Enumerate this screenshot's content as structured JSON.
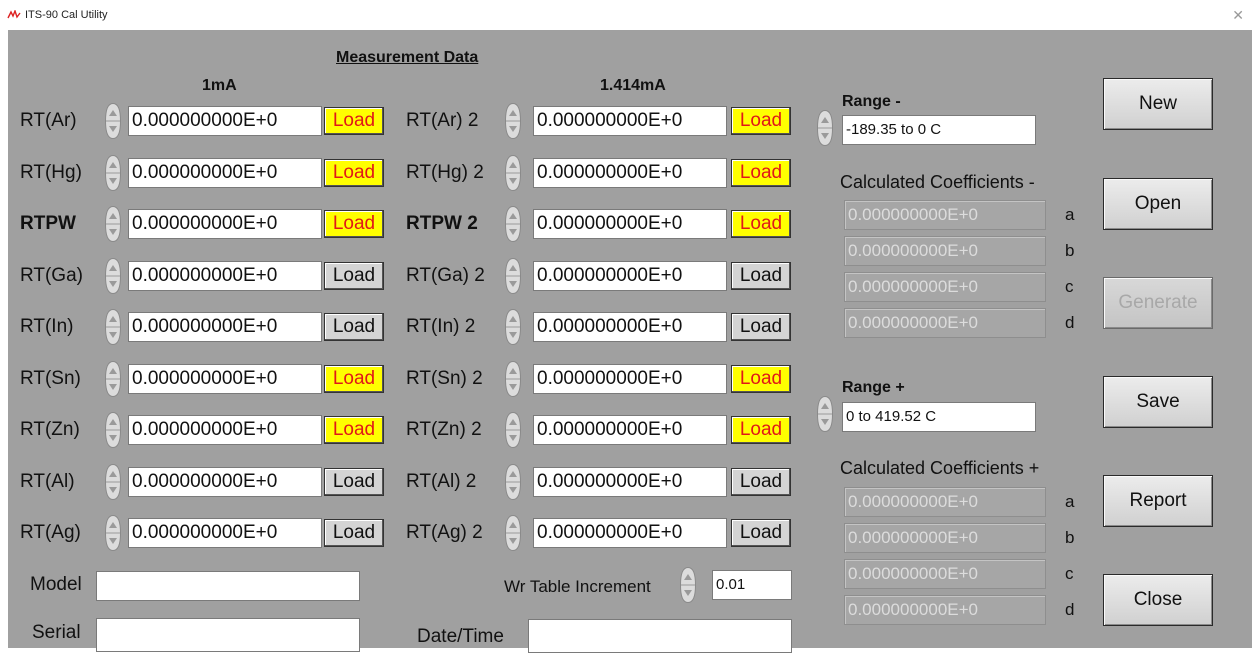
{
  "window": {
    "title": "ITS-90 Cal Utility",
    "close_glyph": "✕"
  },
  "measurement": {
    "title": "Measurement Data",
    "col1_header": "1mA",
    "col2_header": "1.414mA",
    "load_label": "Load",
    "rows": [
      {
        "label1": "RT(Ar)",
        "value1": "0.000000000E+0",
        "hl1": true,
        "label2": "RT(Ar) 2",
        "value2": "0.000000000E+0",
        "hl2": true
      },
      {
        "label1": "RT(Hg)",
        "value1": "0.000000000E+0",
        "hl1": true,
        "label2": "RT(Hg) 2",
        "value2": "0.000000000E+0",
        "hl2": true
      },
      {
        "label1": "RTPW",
        "value1": "0.000000000E+0",
        "hl1": true,
        "label2": "RTPW 2",
        "value2": "0.000000000E+0",
        "hl2": true,
        "bold": true
      },
      {
        "label1": "RT(Ga)",
        "value1": "0.000000000E+0",
        "hl1": false,
        "label2": "RT(Ga) 2",
        "value2": "0.000000000E+0",
        "hl2": false
      },
      {
        "label1": "RT(In)",
        "value1": "0.000000000E+0",
        "hl1": false,
        "label2": "RT(In) 2",
        "value2": "0.000000000E+0",
        "hl2": false
      },
      {
        "label1": "RT(Sn)",
        "value1": "0.000000000E+0",
        "hl1": true,
        "label2": "RT(Sn) 2",
        "value2": "0.000000000E+0",
        "hl2": true
      },
      {
        "label1": "RT(Zn)",
        "value1": "0.000000000E+0",
        "hl1": true,
        "label2": "RT(Zn) 2",
        "value2": "0.000000000E+0",
        "hl2": true
      },
      {
        "label1": "RT(Al)",
        "value1": "0.000000000E+0",
        "hl1": false,
        "label2": "RT(Al) 2",
        "value2": "0.000000000E+0",
        "hl2": false
      },
      {
        "label1": "RT(Ag)",
        "value1": "0.000000000E+0",
        "hl1": false,
        "label2": "RT(Ag) 2",
        "value2": "0.000000000E+0",
        "hl2": false
      }
    ]
  },
  "model": {
    "label": "Model",
    "value": ""
  },
  "serial": {
    "label": "Serial",
    "value": ""
  },
  "wr_table": {
    "label": "Wr Table Increment",
    "value": "0.01"
  },
  "datetime": {
    "label": "Date/Time",
    "value": ""
  },
  "range_minus": {
    "label": "Range -",
    "value": "-189.35 to 0 C",
    "coef_title": "Calculated Coefficients -",
    "coefs": [
      {
        "letter": "a",
        "value": "0.000000000E+0"
      },
      {
        "letter": "b",
        "value": "0.000000000E+0"
      },
      {
        "letter": "c",
        "value": "0.000000000E+0"
      },
      {
        "letter": "d",
        "value": "0.000000000E+0"
      }
    ]
  },
  "range_plus": {
    "label": "Range +",
    "value": "0 to 419.52 C",
    "coef_title": "Calculated Coefficients +",
    "coefs": [
      {
        "letter": "a",
        "value": "0.000000000E+0"
      },
      {
        "letter": "b",
        "value": "0.000000000E+0"
      },
      {
        "letter": "c",
        "value": "0.000000000E+0"
      },
      {
        "letter": "d",
        "value": "0.000000000E+0"
      }
    ]
  },
  "buttons": [
    {
      "key": "new",
      "label": "New",
      "enabled": true
    },
    {
      "key": "open",
      "label": "Open",
      "enabled": true
    },
    {
      "key": "generate",
      "label": "Generate",
      "enabled": false
    },
    {
      "key": "save",
      "label": "Save",
      "enabled": true
    },
    {
      "key": "report",
      "label": "Report",
      "enabled": true
    },
    {
      "key": "close",
      "label": "Close",
      "enabled": true
    }
  ],
  "colors": {
    "panel_bg": "#a0a0a0",
    "load_highlight_bg": "#ffff00",
    "load_highlight_text": "#e01818",
    "coef_disabled_text": "#dcdcdc"
  },
  "icons": {
    "app": "thermometer-app-icon",
    "spinner": "spinner-updown-icon"
  }
}
